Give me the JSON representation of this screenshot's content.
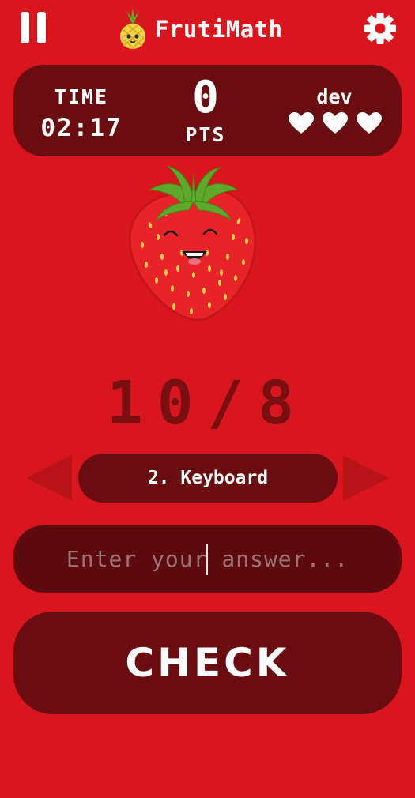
{
  "header": {
    "app_title": "FrutiMath",
    "pause_icon": "pause-icon",
    "logo_icon": "pineapple-logo-icon",
    "settings_icon": "gear-icon"
  },
  "stats": {
    "time_label": "TIME",
    "time_value": "02:17",
    "score_value": "0",
    "score_unit": "PTS",
    "player_name": "dev",
    "lives": 3,
    "heart_icon": "heart-icon"
  },
  "fruit": {
    "icon": "strawberry-character-icon"
  },
  "problem": {
    "text": "10/8"
  },
  "mode": {
    "label": "2. Keyboard",
    "prev_icon": "arrow-left-icon",
    "next_icon": "arrow-right-icon"
  },
  "answer": {
    "value": "",
    "placeholder": "Enter your answer..."
  },
  "check": {
    "label": "CHECK"
  },
  "colors": {
    "background": "#d9161e",
    "panel": "#6a0d10",
    "input_bg": "#5d0b0e",
    "problem_text": "#7a0f12",
    "text": "#ffffff",
    "placeholder": "#9c7375"
  }
}
